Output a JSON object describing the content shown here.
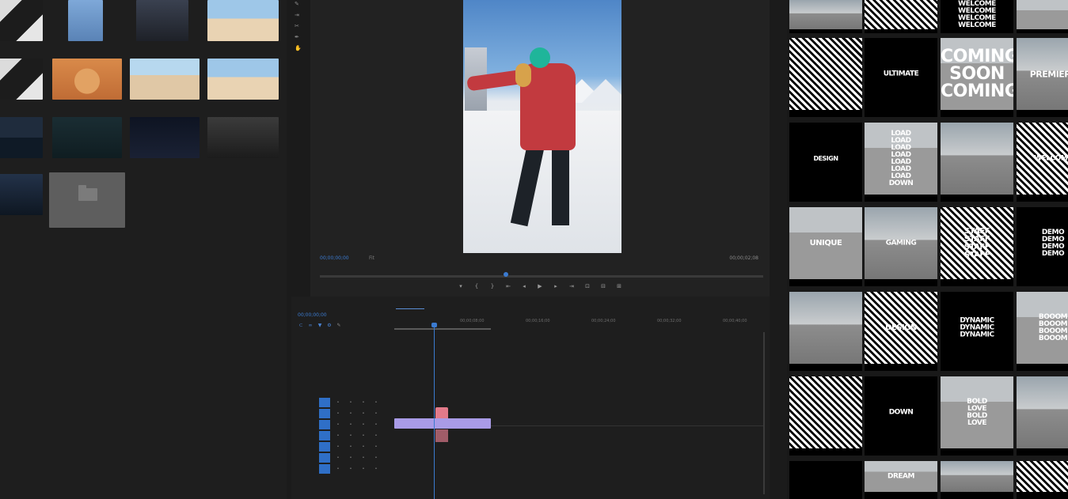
{
  "project": {
    "items": [
      {
        "label": "",
        "duration": "",
        "thumb": "th-bw"
      },
      {
        "label": "",
        "duration": "",
        "thumb": "th-person"
      },
      {
        "label": "",
        "duration": "",
        "thumb": "th-dark"
      },
      {
        "label": "",
        "duration": "",
        "thumb": "th-beach"
      },
      {
        "label": "",
        "duration": "",
        "thumb": "th-bw"
      },
      {
        "label": "",
        "duration": "",
        "thumb": "th-face"
      },
      {
        "label": "",
        "duration": "",
        "thumb": "th-beach2"
      },
      {
        "label": "",
        "duration": "",
        "thumb": "th-beach"
      },
      {
        "label": "",
        "duration": "",
        "thumb": "th-ski"
      },
      {
        "label": "",
        "duration": "",
        "thumb": "th-teal"
      },
      {
        "label": "",
        "duration": "",
        "thumb": "th-night"
      },
      {
        "label": "",
        "duration": "",
        "thumb": "th-mono"
      },
      {
        "label": "",
        "duration": "",
        "thumb": "th-ski2"
      },
      {
        "label": "",
        "duration": "",
        "thumb": "th-folder"
      }
    ]
  },
  "program_monitor": {
    "timecode_left": "00;00;00;00",
    "fit_label": "Fit",
    "timecode_right": "00;00;02;08",
    "playhead_fraction": 0.42,
    "transport": [
      "mark-in-icon",
      "mark-out-icon",
      "go-to-in-icon",
      "step-back-icon",
      "play-icon",
      "step-forward-icon",
      "go-to-out-icon",
      "lift-icon",
      "extract-icon",
      "export-frame-icon",
      "compare-icon"
    ]
  },
  "timeline": {
    "tabs": [
      "",
      "",
      "",
      ""
    ],
    "timecode": "00;00;00;00",
    "ruler": [
      "",
      "00;00;08;00",
      "00;00;16;00",
      "00;00;24;00",
      "00;00;32;00",
      "00;00;40;00"
    ],
    "clip_label": "",
    "playhead_fraction": 0.11
  },
  "templates": {
    "cards": [
      {
        "text": "",
        "label": ""
      },
      {
        "text": "",
        "label": ""
      },
      {
        "text": "WELCOME\nWELCOME\nWELCOME\nWELCOME",
        "label": ""
      },
      {
        "text": "",
        "label": ""
      },
      {
        "text": "",
        "label": ""
      },
      {
        "text": "ULTIMATE",
        "label": ""
      },
      {
        "text": "COMING\nSOON\nCOMING",
        "label": ""
      },
      {
        "text": "PREMIERE",
        "label": ""
      },
      {
        "text": "DESIGN",
        "label": ""
      },
      {
        "text": "LOAD\nLOAD\nLOAD\nLOAD\nLOAD\nLOAD\nLOAD\nDOWN",
        "label": ""
      },
      {
        "text": "",
        "label": ""
      },
      {
        "text": "WELCOME",
        "label": ""
      },
      {
        "text": "UNIQUE",
        "label": ""
      },
      {
        "text": "GAMING",
        "label": ""
      },
      {
        "text": "STAFF\nSTAFF\nSTAFF\nSTAFF",
        "label": ""
      },
      {
        "text": "DEMO\nDEMO\nDEMO\nDEMO",
        "label": ""
      },
      {
        "text": "",
        "label": ""
      },
      {
        "text": "DESIGN",
        "label": ""
      },
      {
        "text": "DYNAMIC\nDYNAMIC\nDYNAMIC",
        "label": ""
      },
      {
        "text": "BOOOM\nBOOOM\nBOOOM\nBOOOM",
        "label": ""
      },
      {
        "text": "",
        "label": ""
      },
      {
        "text": "DOWN",
        "label": ""
      },
      {
        "text": "BOLD\nLOVE\nBOLD\nLOVE",
        "label": ""
      },
      {
        "text": "",
        "label": ""
      },
      {
        "text": "",
        "label": ""
      },
      {
        "text": "DREAM",
        "label": ""
      },
      {
        "text": "",
        "label": ""
      },
      {
        "text": "",
        "label": ""
      }
    ]
  }
}
